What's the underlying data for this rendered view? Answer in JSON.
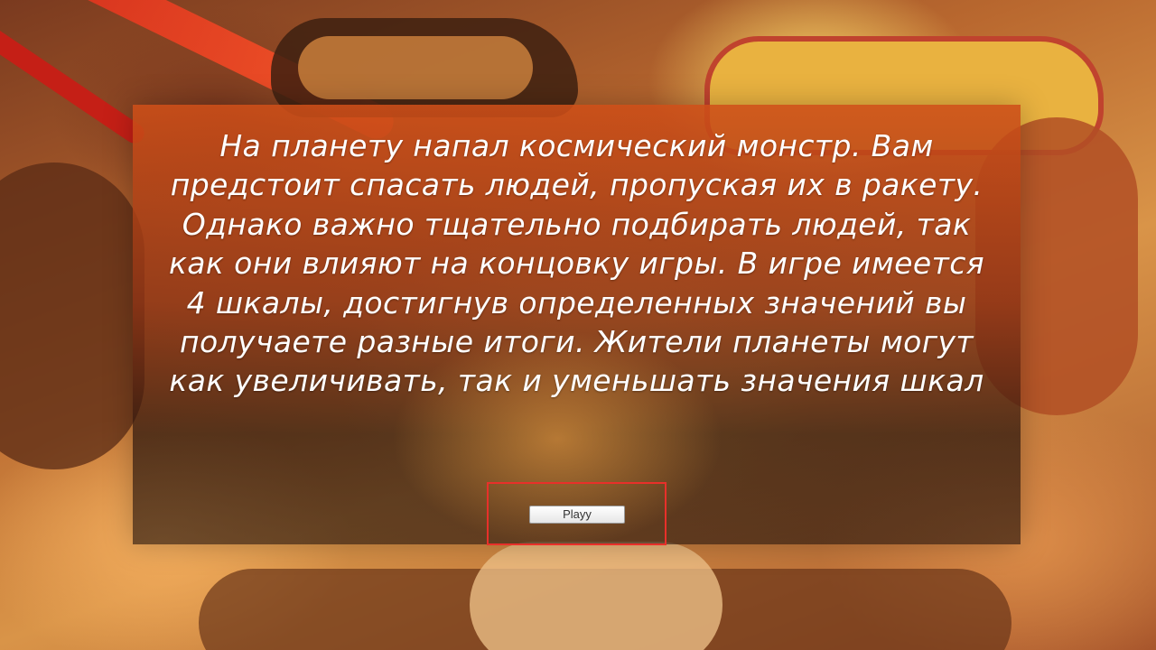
{
  "intro": {
    "text": "На планету напал космический монстр. Вам предстоит спасать людей, пропуская их в ракету. Однако важно тщательно подбирать людей, так как они влияют на концовку игры. В игре имеется 4 шкалы, достигнув определенных значений вы получаете разные итоги. Жители планеты могут как увеличивать, так и уменьшать значения шкал"
  },
  "play_button": {
    "label": "Playy"
  },
  "colors": {
    "highlight": "#e8302a",
    "text": "#ffffff"
  }
}
